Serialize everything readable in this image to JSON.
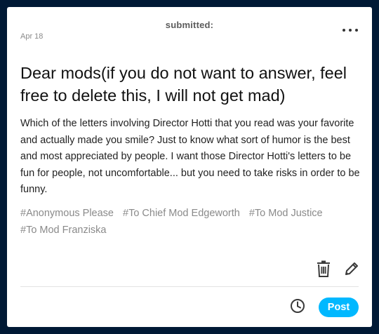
{
  "post": {
    "header_label": "submitted:",
    "date": "Apr 18",
    "title": "Dear mods(if you do not want to answer, feel free to delete this, I will not get mad)",
    "body": "Which of the letters involving Director Hotti that you read was your favorite and actually made you smile? Just to know what sort of humor is the best and most appreciated by people. I want those Director Hotti's letters to be fun for people, not uncomfortable... but you need to take risks in order to be funny.",
    "tags": [
      "#Anonymous Please",
      "#To Chief Mod Edgeworth",
      "#To Mod Justice",
      "#To Mod Franziska"
    ]
  },
  "actions": {
    "post_label": "Post",
    "icons": {
      "more": "more-icon",
      "delete": "trash-icon",
      "edit": "pencil-icon",
      "schedule": "clock-icon"
    }
  },
  "colors": {
    "background": "#001935",
    "accent": "#00b8ff"
  }
}
